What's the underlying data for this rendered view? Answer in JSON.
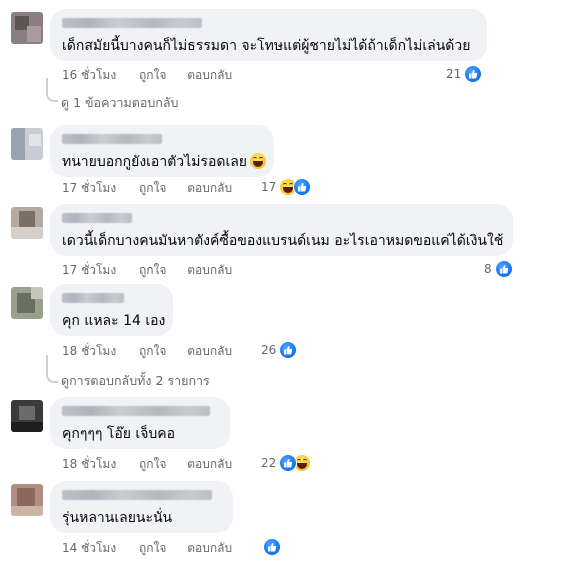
{
  "comments": [
    {
      "text": "เด็กสมัยนี้บางคนก็ไม่ธรรมดา จะโทษแต่ผู้ชายไม่ได้ถ้าเด็กไม่เล่นด้วย",
      "time": "16 ชั่วโมง",
      "like": "ถูกใจ",
      "reply": "ตอบกลับ",
      "reaction_count": "21",
      "reactions": [
        "like-icon"
      ]
    },
    {
      "text": "ทนายบอกกูยังเอาตัวไม่รอดเลย",
      "time": "17 ชั่วโมง",
      "like": "ถูกใจ",
      "reply": "ตอบกลับ",
      "reaction_count": "17",
      "reactions": [
        "haha-icon",
        "like-icon"
      ]
    },
    {
      "text": "เดวนี้เด็กบางคนมันหาตังค์ซื้อของแบรนด์เนม อะไรเอาหมดขอแค่ได้เงินใช้",
      "time": "17 ชั่วโมง",
      "like": "ถูกใจ",
      "reply": "ตอบกลับ",
      "reaction_count": "8",
      "reactions": [
        "like-icon"
      ]
    },
    {
      "text": "คุก แหละ 14 เอง",
      "time": "18 ชั่วโมง",
      "like": "ถูกใจ",
      "reply": "ตอบกลับ",
      "reaction_count": "26",
      "reactions": [
        "like-icon"
      ]
    },
    {
      "text": "คุกๆๆๆ โอ๊ย เจ็บคอ",
      "time": "18 ชั่วโมง",
      "like": "ถูกใจ",
      "reply": "ตอบกลับ",
      "reaction_count": "22",
      "reactions": [
        "like-icon",
        "haha-icon"
      ]
    },
    {
      "text": "รุ่นหลานเลยนะนั่น",
      "time": "14 ชั่วโมง",
      "like": "ถูกใจ",
      "reply": "ตอบกลับ",
      "reaction_count": "",
      "reactions": [
        "like-icon"
      ]
    }
  ],
  "view_replies": [
    "ดู 1 ข้อความตอบกลับ",
    "ดูการตอบกลับทั้ง 2 รายการ"
  ],
  "colors": {
    "bubble": "#f0f2f5",
    "meta_text": "#65676b",
    "like_blue": "#1877f2",
    "haha_yellow": "#f7c62a"
  }
}
